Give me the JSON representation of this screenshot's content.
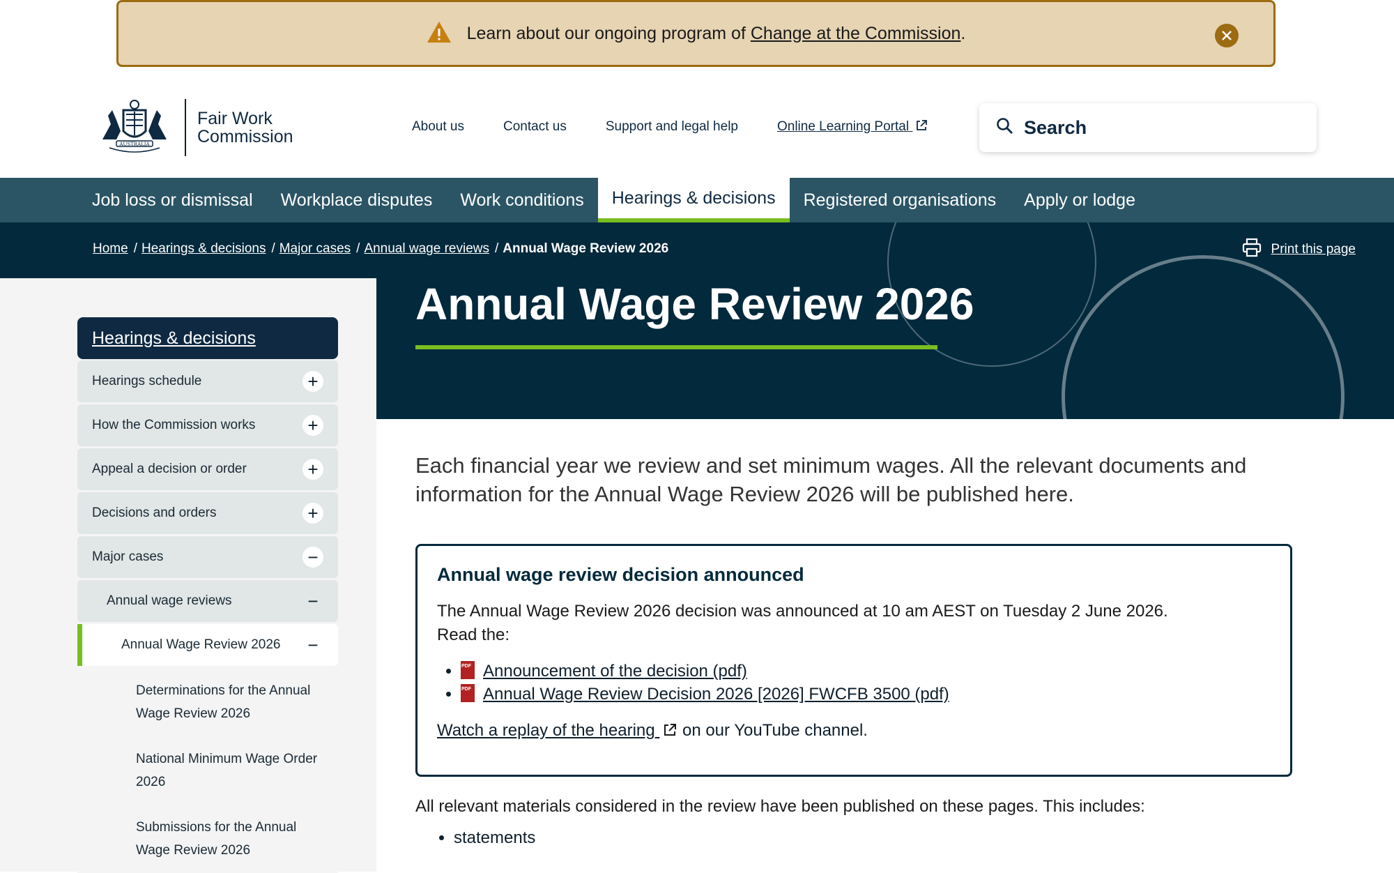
{
  "alert": {
    "text": "Learn about our ongoing program of ",
    "link": "Change at the Commission",
    "suffix": "."
  },
  "logo": {
    "line1": "Fair Work",
    "line2": "Commission",
    "crest_text": "AUSTRALIA"
  },
  "utility_nav": [
    "About us",
    "Contact us",
    "Support and legal help",
    "Online Learning Portal"
  ],
  "search": {
    "label": "Search"
  },
  "main_nav": [
    "Job loss or dismissal",
    "Workplace disputes",
    "Work conditions",
    "Hearings & decisions",
    "Registered organisations",
    "Apply or lodge"
  ],
  "breadcrumb": [
    "Home",
    "Hearings & decisions",
    "Major cases",
    "Annual wage reviews",
    "Annual Wage Review 2026"
  ],
  "print_label": "Print this page",
  "page_title": "Annual Wage Review 2026",
  "sidebar": {
    "heading": "Hearings & decisions",
    "items": [
      "Hearings schedule",
      "How the Commission works",
      "Appeal a decision or order",
      "Decisions and orders",
      "Major cases",
      "Annual wage reviews",
      "Annual Wage Review 2026"
    ],
    "children": [
      "Determinations for the Annual Wage Review 2026",
      "National Minimum Wage Order 2026",
      "Submissions for the Annual Wage Review 2026"
    ]
  },
  "intro": "Each financial year we review and set minimum wages. All the relevant documents and information for the Annual Wage Review 2026 will be published here.",
  "notice": {
    "heading": "Annual wage review decision announced",
    "body1": "The Annual Wage Review 2026 decision was announced at 10 am AEST on Tuesday 2 June 2026.",
    "body2": "Read the:",
    "links": [
      "Announcement of the decision (pdf)",
      "Annual Wage Review Decision 2026 [2026] FWCFB 3500 (pdf)"
    ],
    "watch_link": "Watch a replay of the hearing",
    "watch_suffix": " on our YouTube channel."
  },
  "after_text": "All relevant materials considered in the review have been published on these pages. This includes:",
  "after_list": [
    "statements"
  ],
  "colors": {
    "accent_green": "#78be20",
    "nav_bg": "#2b5565",
    "hero_bg": "#02293c",
    "alert_bg": "#e6d4b3",
    "alert_border": "#9c6b12"
  }
}
